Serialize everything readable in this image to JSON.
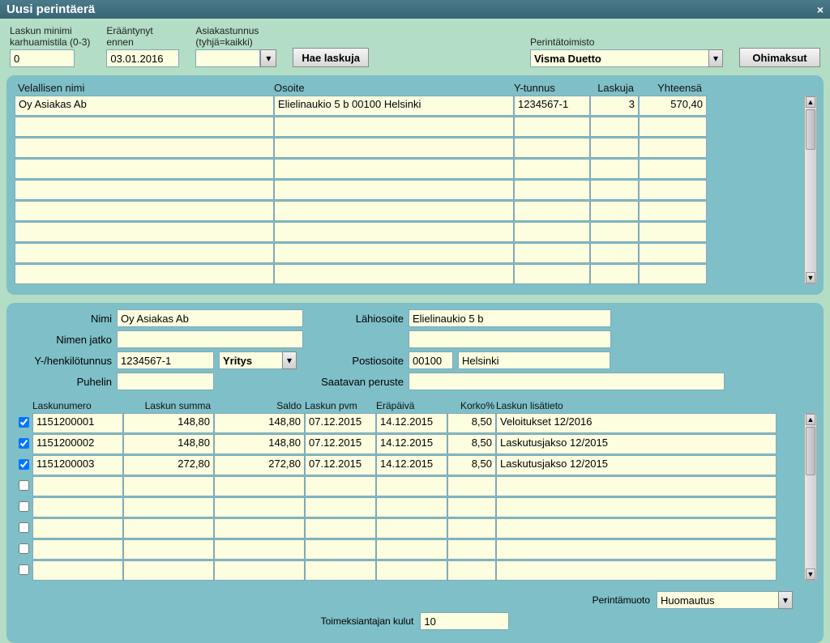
{
  "title": "Uusi perintäerä",
  "top": {
    "minimi_label1": "Laskun minimi",
    "minimi_label2": "karhuamistila (0-3)",
    "minimi_value": "0",
    "due_label1": "Erääntynyt",
    "due_label2": "ennen",
    "due_value": "03.01.2016",
    "cust_label1": "Asiakastunnus",
    "cust_label2": "(tyhjä=kaikki)",
    "cust_value": "",
    "hae_btn": "Hae laskuja",
    "agency_label": "Perintätoimisto",
    "agency_value": "Visma Duetto",
    "ohimaksut_btn": "Ohimaksut"
  },
  "grid1": {
    "headers": {
      "c1": "Velallisen nimi",
      "c2": "Osoite",
      "c3": "Y-tunnus",
      "c4": "Laskuja",
      "c5": "Yhteensä"
    },
    "rows": [
      {
        "c1": "Oy Asiakas Ab",
        "c2": "Elielinaukio 5 b  00100 Helsinki",
        "c3": "1234567-1",
        "c4": "3",
        "c5": "570,40"
      }
    ]
  },
  "details": {
    "nimi_l": "Nimi",
    "nimi": "Oy Asiakas Ab",
    "nimenjatko_l": "Nimen jatko",
    "nimenjatko": "",
    "ytunnus_l": "Y-/henkilötunnus",
    "ytunnus": "1234567-1",
    "tyyppi": "Yritys",
    "puhelin_l": "Puhelin",
    "puhelin": "",
    "lahi_l": "Lähiosoite",
    "lahi": "Elielinaukio 5 b",
    "lahi2": "",
    "posti_l": "Postiosoite",
    "posti_zip": "00100",
    "posti_city": "Helsinki",
    "peruste_l": "Saatavan peruste",
    "peruste": ""
  },
  "grid2": {
    "headers": {
      "c1": "Laskunumero",
      "c2": "Laskun summa",
      "c3": "Saldo",
      "c4": "Laskun pvm",
      "c5": "Eräpäivä",
      "c6": "Korko%",
      "c7": "Laskun lisätieto"
    },
    "rows": [
      {
        "chk": true,
        "c1": "1151200001",
        "c2": "148,80",
        "c3": "148,80",
        "c4": "07.12.2015",
        "c5": "14.12.2015",
        "c6": "8,50",
        "c7": "Veloitukset 12/2016"
      },
      {
        "chk": true,
        "c1": "1151200002",
        "c2": "148,80",
        "c3": "148,80",
        "c4": "07.12.2015",
        "c5": "14.12.2015",
        "c6": "8,50",
        "c7": "Laskutusjakso 12/2015"
      },
      {
        "chk": true,
        "c1": "1151200003",
        "c2": "272,80",
        "c3": "272,80",
        "c4": "07.12.2015",
        "c5": "14.12.2015",
        "c6": "8,50",
        "c7": "Laskutusjakso 12/2015"
      }
    ]
  },
  "bottom": {
    "perintamuoto_l": "Perintämuoto",
    "perintamuoto": "Huomautus",
    "kulut_l": "Toimeksiantajan kulut",
    "kulut": "10"
  }
}
